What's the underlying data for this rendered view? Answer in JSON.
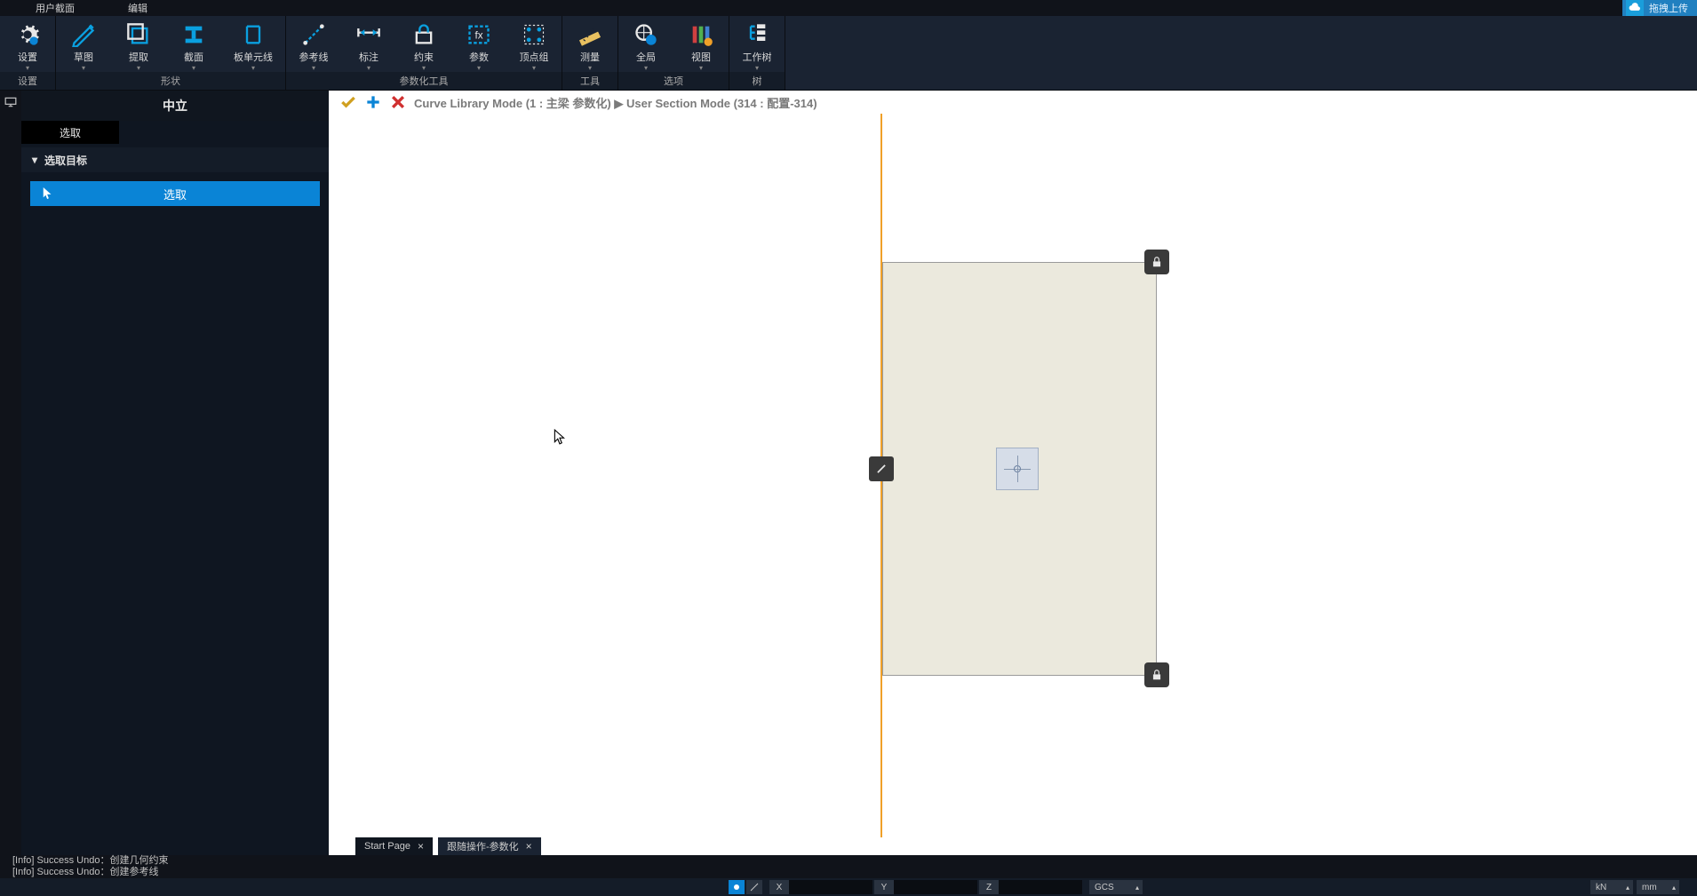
{
  "menubar": {
    "user_interface": "用户截面",
    "edit": "编辑",
    "upload": "拖拽上传"
  },
  "ribbon": {
    "groups": [
      {
        "label": "设置",
        "items": [
          {
            "label": "设置",
            "icon": "gear"
          }
        ]
      },
      {
        "label": "形状",
        "items": [
          {
            "label": "草图",
            "icon": "sketch"
          },
          {
            "label": "提取",
            "icon": "extract"
          },
          {
            "label": "截面",
            "icon": "section"
          },
          {
            "label": "板单元线",
            "icon": "plate-line"
          }
        ]
      },
      {
        "label": "参数化工具",
        "items": [
          {
            "label": "参考线",
            "icon": "ref-line"
          },
          {
            "label": "标注",
            "icon": "dimension"
          },
          {
            "label": "约束",
            "icon": "constraint"
          },
          {
            "label": "参数",
            "icon": "param"
          },
          {
            "label": "顶点组",
            "icon": "vertex-grp"
          }
        ]
      },
      {
        "label": "工具",
        "items": [
          {
            "label": "测量",
            "icon": "measure"
          }
        ]
      },
      {
        "label": "选项",
        "items": [
          {
            "label": "全局",
            "icon": "global-gear"
          },
          {
            "label": "视图",
            "icon": "view"
          }
        ]
      },
      {
        "label": "树",
        "items": [
          {
            "label": "工作树",
            "icon": "tree"
          }
        ]
      }
    ]
  },
  "left": {
    "title": "中立",
    "tab": "选取",
    "section": "选取目标",
    "select_btn": "选取"
  },
  "canvas": {
    "breadcrumb": {
      "curve_mode": "Curve Library Mode (1 : 主梁 参数化)",
      "section_mode": "User Section Mode (314 : 配置-314)"
    },
    "tabs": [
      {
        "label": "Start Page",
        "closable": true
      },
      {
        "label": "跟随操作-参数化",
        "closable": true,
        "active": true
      }
    ]
  },
  "log": {
    "line1": "[Info] Success Undo：创建几何约束",
    "line2": "[Info] Success Undo：创建参考线"
  },
  "status": {
    "coord_x": "X",
    "coord_y": "Y",
    "coord_z": "Z",
    "cs": "GCS",
    "force_unit": "kN",
    "length_unit": "mm"
  }
}
